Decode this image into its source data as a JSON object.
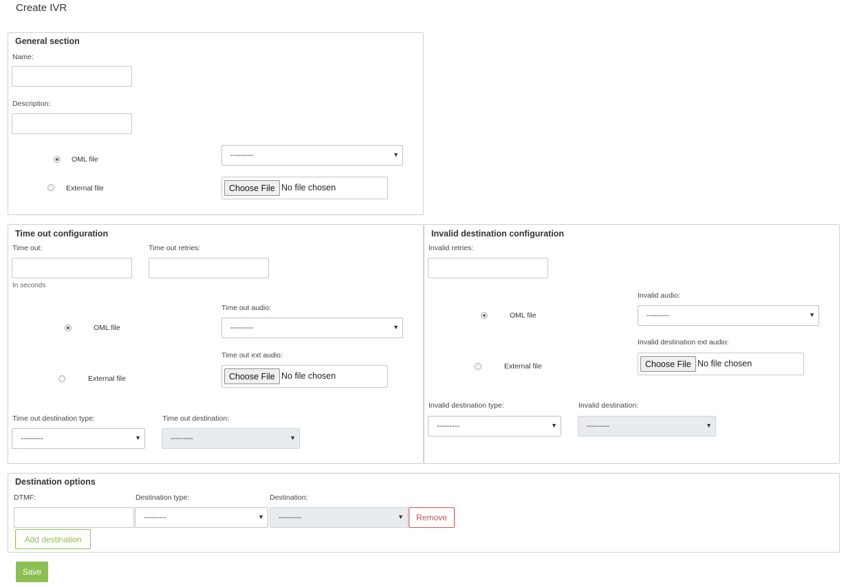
{
  "page": {
    "title": "Create IVR"
  },
  "general": {
    "title": "General section",
    "name_label": "Name:",
    "name_value": "",
    "description_label": "Description:",
    "description_value": "",
    "oml_label": "OML file",
    "external_label": "External file",
    "audio_select": "---------",
    "file_button": "Choose File",
    "file_status": "No file chosen",
    "selected_source": "OML file"
  },
  "timeout": {
    "title": "Time out configuration",
    "timeout_label": "Time out:",
    "timeout_value": "",
    "timeout_hint": "In seconds",
    "retries_label": "Time out retries:",
    "retries_value": "",
    "audio_label": "Time out audio:",
    "audio_select": "---------",
    "ext_audio_label": "Time out ext audio:",
    "oml_label": "OML file",
    "external_label": "External file",
    "file_button": "Choose File",
    "file_status": "No file chosen",
    "dest_type_label": "Time out destination type:",
    "dest_type_select": "---------",
    "dest_label": "Time out destination:",
    "dest_select": "---------",
    "selected_source": "OML file"
  },
  "invalid": {
    "title": "Invalid destination configuration",
    "retries_label": "Invalid retries:",
    "retries_value": "",
    "audio_label": "Invalid audio:",
    "audio_select": "---------",
    "ext_audio_label": "Invalid destination ext audio:",
    "oml_label": "OML file",
    "external_label": "External file",
    "file_button": "Choose File",
    "file_status": "No file chosen",
    "dest_type_label": "Invalid destination type:",
    "dest_type_select": "---------",
    "dest_label": "Invalid destination:",
    "dest_select": "---------",
    "selected_source": "OML file"
  },
  "destinations": {
    "title": "Destination options",
    "dtmf_label": "DTMF:",
    "dtmf_value": "",
    "type_label": "Destination type:",
    "type_select": "---------",
    "dest_label": "Destination:",
    "dest_select": "---------",
    "remove_label": "Remove",
    "add_label": "Add destination"
  },
  "actions": {
    "save_label": "Save"
  },
  "colors": {
    "success": "#8cc152",
    "danger": "#d9534f",
    "border": "#cfcfcf",
    "disabled": "#e9ecef"
  },
  "icons": {
    "select_arrow": "chevron-down-icon"
  }
}
